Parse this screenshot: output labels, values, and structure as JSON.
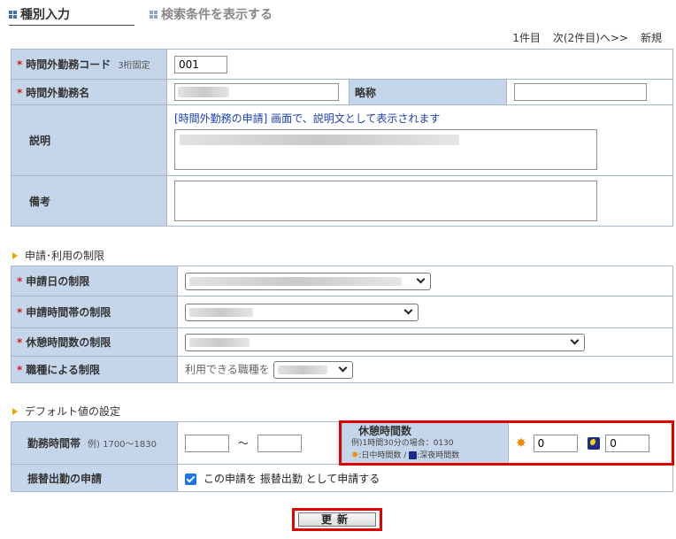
{
  "tabs": {
    "active_label": "種別入力",
    "search_label": "検索条件を表示する"
  },
  "pager": {
    "count": "1件目",
    "next": "次(2件目)へ>>",
    "new": "新規"
  },
  "basic": {
    "code_label": "時間外勤務コード",
    "code_note": "3桁固定",
    "code_value": "001",
    "name_label": "時間外勤務名",
    "abbr_label": "略称",
    "desc_label": "説明",
    "desc_note": "[時間外勤務の申請] 画面で、説明文として表示されます",
    "remarks_label": "備考"
  },
  "restrictions": {
    "section_title": "申請･利用の制限",
    "date_label": "申請日の制限",
    "timeband_label": "申請時間帯の制限",
    "break_label": "休憩時間数の制限",
    "jobtype_label": "職種による制限",
    "jobtype_prefix": "利用できる職種を"
  },
  "defaults": {
    "section_title": "デフォルト値の設定",
    "work_label": "勤務時間帯",
    "work_note": "例) 1700〜1830",
    "tilde": "〜",
    "break_title": "休憩時間数",
    "break_example": "例)1時間30分の場合：0130",
    "break_day": ":日中時間数 /",
    "break_night": ":深夜時間数",
    "day_value": "0",
    "night_value": "0",
    "transfer_label": "振替出勤の申請",
    "transfer_text": "この申請を 振替出勤 として申請する"
  },
  "actions": {
    "update": "更新"
  },
  "colors": {
    "label_bg": "#c6d6ea",
    "required": "#d21f1f",
    "highlight": "#e00000"
  }
}
